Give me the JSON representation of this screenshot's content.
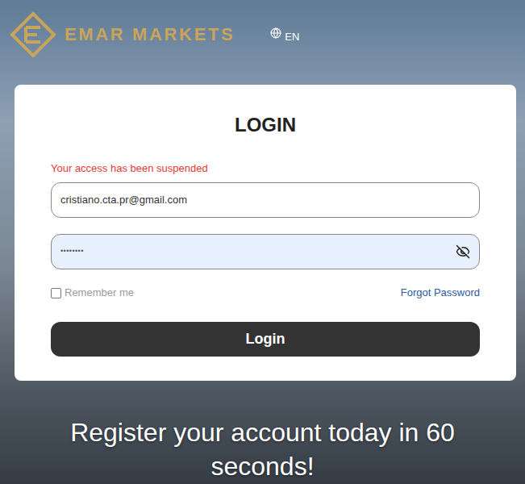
{
  "header": {
    "logo": {
      "text": "EMAR MARKETS"
    },
    "language": "EN"
  },
  "login": {
    "title": "LOGIN",
    "error": "Your access has been suspended",
    "email": {
      "value": "cristiano.cta.pr@gmail.com"
    },
    "password": {
      "value": "••••••••",
      "masked": true
    },
    "remember_me": {
      "label": "Remember me",
      "checked": false
    },
    "forgot_password": "Forgot Password",
    "button": "Login"
  },
  "tagline": "Register your account today in 60 seconds!"
}
